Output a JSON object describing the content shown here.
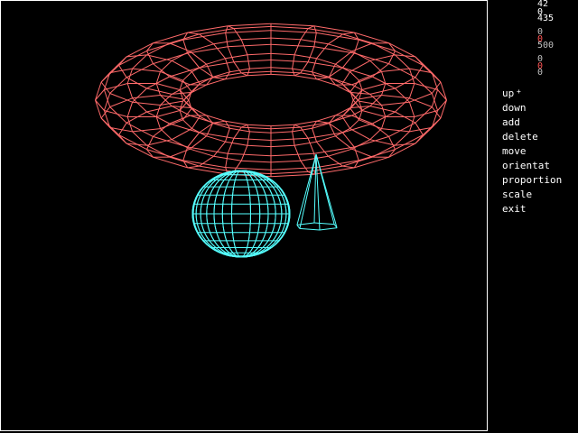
{
  "colors": {
    "background": "#000000",
    "torus": "#ff6a6a",
    "sphere": "#55ffff",
    "cone": "#55ffff",
    "text": "#ffffff",
    "readout_red": "#ff5555",
    "readout_gray": "#c0c0c0"
  },
  "readouts": [
    {
      "value": "42",
      "color": "#ffffff"
    },
    {
      "value": "0",
      "color": "#ffffff"
    },
    {
      "value": "435",
      "color": "#ffffff"
    },
    {
      "value": "0",
      "color": "#c0c0c0"
    },
    {
      "value": "0",
      "color": "#ff5555"
    },
    {
      "value": "500",
      "color": "#c0c0c0"
    },
    {
      "value": "0",
      "color": "#c0c0c0"
    },
    {
      "value": "0",
      "color": "#ff5555"
    },
    {
      "value": "0",
      "color": "#c0c0c0"
    }
  ],
  "menu": [
    {
      "label": "up",
      "name": "menu-up"
    },
    {
      "label": "down",
      "name": "menu-down"
    },
    {
      "label": "add",
      "name": "menu-add"
    },
    {
      "label": "delete",
      "name": "menu-delete"
    },
    {
      "label": "move",
      "name": "menu-move"
    },
    {
      "label": "orientat",
      "name": "menu-orientat"
    },
    {
      "label": "proportion",
      "name": "menu-proportion"
    },
    {
      "label": "scale",
      "name": "menu-scale"
    },
    {
      "label": "exit",
      "name": "menu-exit"
    }
  ],
  "cursor": "+",
  "objects": [
    "torus",
    "sphere",
    "cone"
  ]
}
